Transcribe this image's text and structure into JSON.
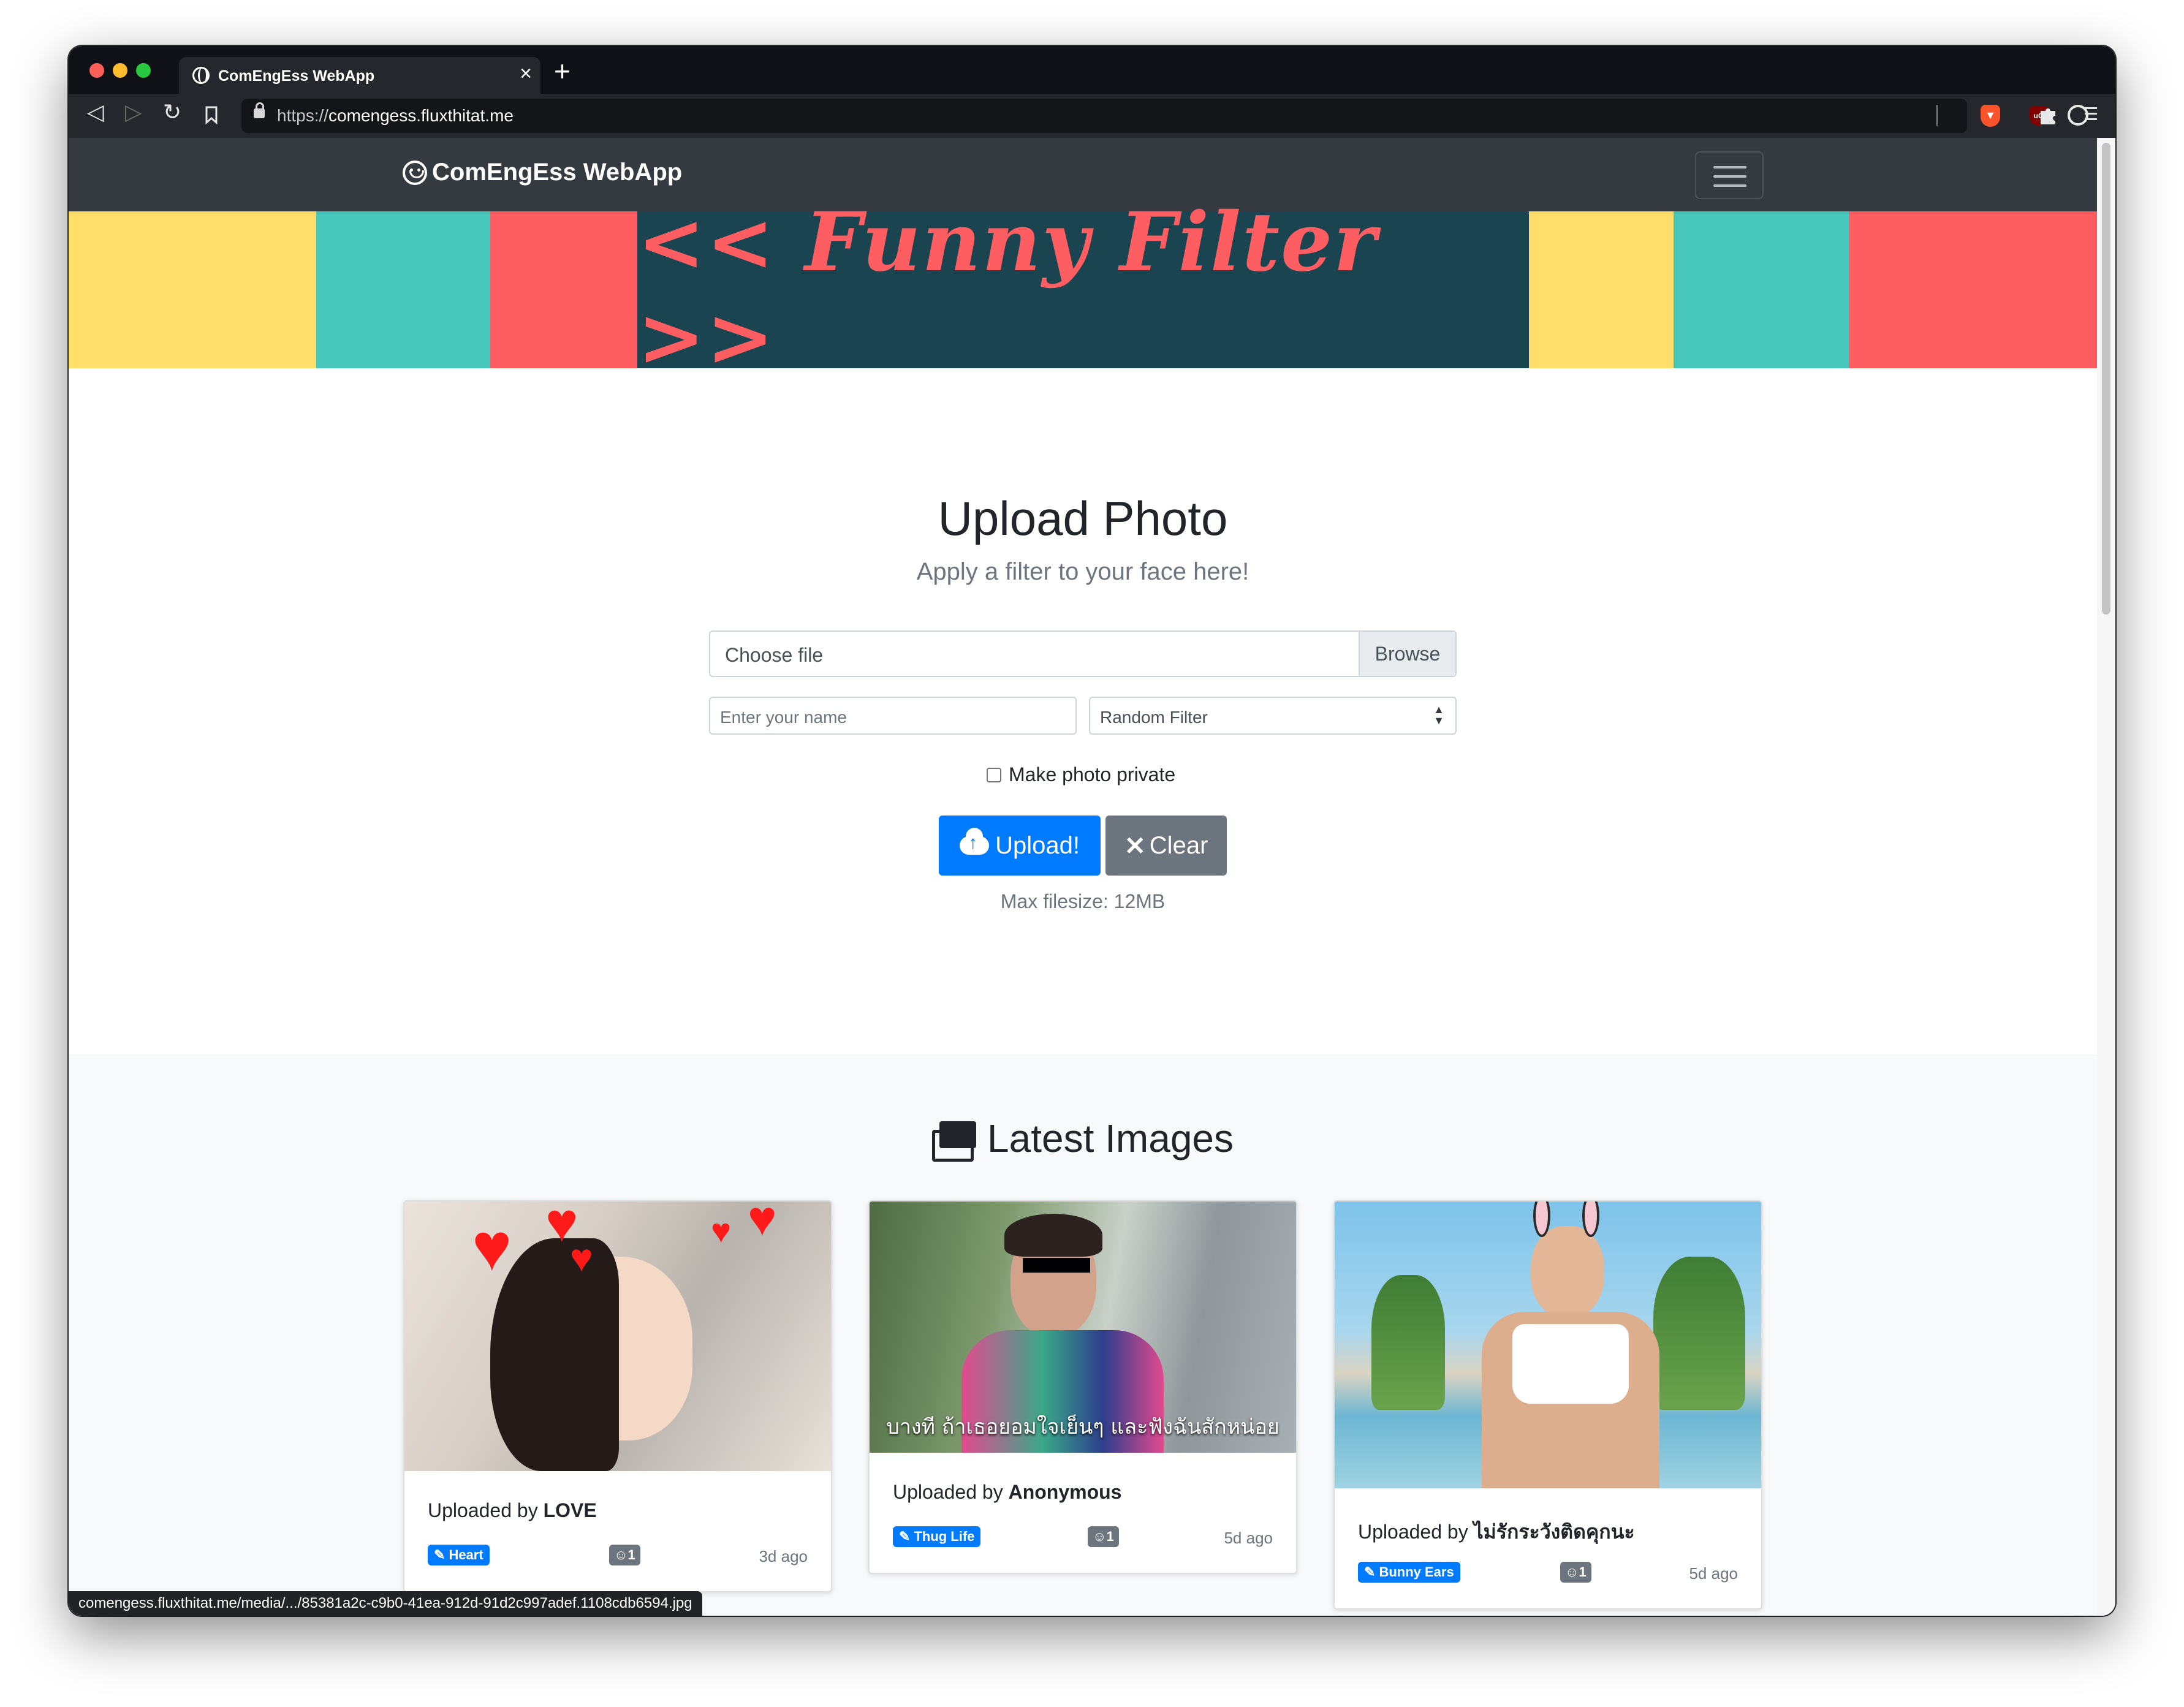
{
  "browser": {
    "tab_title": "ComEngEss WebApp",
    "tab_close": "×",
    "new_tab": "+",
    "url_scheme": "https://",
    "url_host": "comengess.fluxthitat.me",
    "status_url": "comengess.fluxthitat.me/media/.../85381a2c-c9b0-41ea-912d-91d2c997adef.1108cdb6594.jpg"
  },
  "navbar": {
    "brand": "ComEngEss WebApp"
  },
  "banner": {
    "title": "<< Funny Filter >>"
  },
  "upload": {
    "heading": "Upload Photo",
    "subheading": "Apply a filter to your face here!",
    "file_placeholder": "Choose file",
    "browse_label": "Browse",
    "name_placeholder": "Enter your name",
    "filter_selected": "Random Filter",
    "private_label": "Make photo private",
    "upload_label": "Upload!",
    "clear_label": "Clear",
    "max_filesize": "Max filesize: 12MB"
  },
  "latest": {
    "heading": "Latest Images",
    "cards": [
      {
        "uploaded_by_prefix": "Uploaded by",
        "uploader": "LOVE",
        "filter": "Heart",
        "count": "1",
        "ago": "3d ago"
      },
      {
        "uploaded_by_prefix": "Uploaded by",
        "uploader": "Anonymous",
        "filter": "Thug Life",
        "count": "1",
        "ago": "5d ago",
        "caption": "บางที ถ้าเธอยอมใจเย็นๆ และฟังฉันสักหน่อย"
      },
      {
        "uploaded_by_prefix": "Uploaded by",
        "uploader": "ไม่รักระวังติดคุกนะ",
        "filter": "Bunny Ears",
        "count": "1",
        "ago": "5d ago"
      }
    ]
  },
  "colors": {
    "banner_yellow": "#ffde6a",
    "banner_teal": "#47c7bb",
    "banner_red": "#fe5e61",
    "banner_dark": "#1a4550",
    "primary": "#007bff",
    "secondary": "#6c757d"
  }
}
